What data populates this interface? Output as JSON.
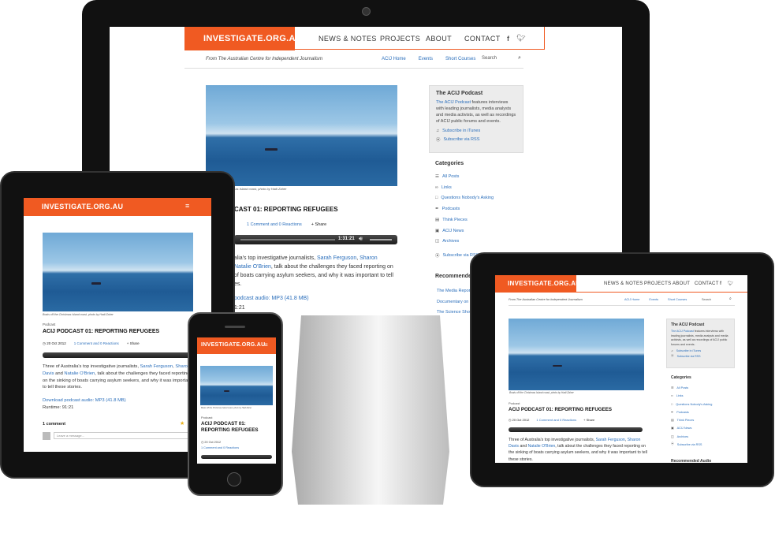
{
  "site": {
    "logo": "INVESTIGATE.ORG.AU",
    "nav": [
      "NEWS & NOTES",
      "PROJECTS",
      "ABOUT",
      "CONTACT"
    ],
    "social": [
      "f",
      "t"
    ],
    "tagline": "From The Australian Centre for Independent Journalism",
    "subnav": [
      "ACIJ Home",
      "Events",
      "Short Courses"
    ],
    "search_placeholder": "Search"
  },
  "article": {
    "image_caption": "Boats off the Christmas Island coast, photo by Hadi Zaher",
    "category": "Podcast",
    "title": "ACIJ PODCAST 01: REPORTING REFUGEES",
    "title_monitor": "CAST 01: REPORTING REFUGEES",
    "title_phone_1": "ACIJ PODCAST 01:",
    "title_phone_2": "REPORTING REFUGEES",
    "date": "20 Oct 2012",
    "comments": "1 Comment and 0 Reactions",
    "share": "Share",
    "player_time": "1:31:21",
    "body_1": "Three of Australia's top investigative journalists,",
    "name_1": "Sarah Ferguson",
    "name_2": "Sharon Davis",
    "and": "and",
    "name_3": "Natalie O'Brien",
    "body_2": ", talk about the challenges they faced reporting on the sinking of boats carrying asylum seekers, and why it was important to tell these stories.",
    "download": "Download podcast audio: MP3 (41.8 MB)",
    "runtime": "Runtime: 91:21",
    "comment_count": "1 comment",
    "comment_placeholder": "Leave a message..."
  },
  "monitor_body": {
    "line1_a": "stralia's top investigative journalists,",
    "line1_b": "Sarah Ferguson",
    "line1_c": "Sharon",
    "line2_a": "Natalie O'Brien",
    "line2_b": ", talk about the challenges they faced reporting on",
    "line3": "of boats carrying asylum seekers, and why it was important to tell",
    "line4": "es.",
    "download": "podcast audio: MP3 (41.8 MB)",
    "runtime": "1:21",
    "caption": "mas Island coast, photo by Hadi Zaher"
  },
  "sidebar": {
    "podcast_title": "The ACIJ Podcast",
    "podcast_link": "The ACIJ Podcast",
    "podcast_text": " features interviews with leading journalists, media analysts and media activists, as well as recordings of ACIJ public forums and events.",
    "itunes": "Subscribe in iTunes",
    "rss": "Subscribe via RSS",
    "categories_title": "Categories",
    "categories": [
      "All Posts",
      "Links",
      "Questions Nobody's Asking",
      "Podcasts",
      "Think Pieces",
      "ACIJ News",
      "Archives"
    ],
    "subscribe_rss": "Subscribe via RSS",
    "recommended_title": "Recommended Audio",
    "recommended": [
      "The Media Report",
      "Documentary on ...",
      "The Science Show"
    ]
  }
}
